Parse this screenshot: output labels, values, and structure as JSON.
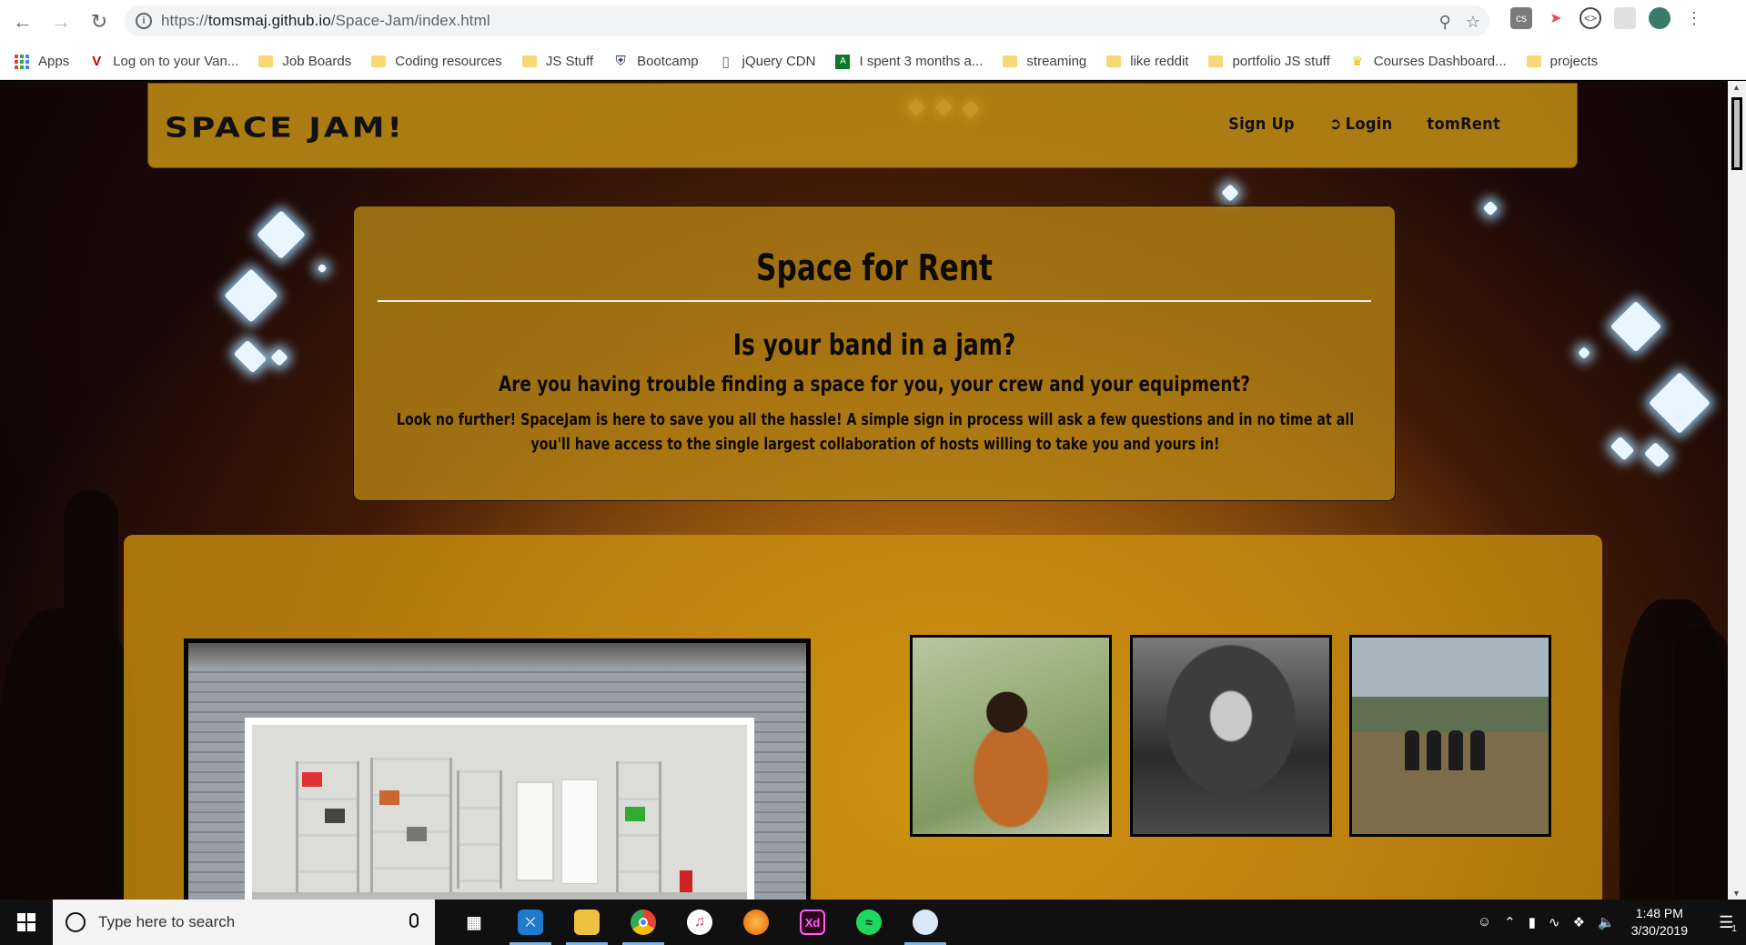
{
  "browser": {
    "url_scheme": "https://",
    "url_host": "tomsmaj.github.io",
    "url_path": "/Space-Jam/index.html",
    "bookmarks": [
      {
        "label": "Apps",
        "icon": "apps-grid-icon"
      },
      {
        "label": "Log on to your Van...",
        "icon": "vanguard-v-icon"
      },
      {
        "label": "Job Boards",
        "icon": "folder-icon"
      },
      {
        "label": "Coding resources",
        "icon": "folder-icon"
      },
      {
        "label": "JS Stuff",
        "icon": "folder-icon"
      },
      {
        "label": "Bootcamp",
        "icon": "shield-icon"
      },
      {
        "label": "jQuery CDN",
        "icon": "page-icon"
      },
      {
        "label": "I spent 3 months a...",
        "icon": "green-a-icon"
      },
      {
        "label": "streaming",
        "icon": "folder-icon"
      },
      {
        "label": "like reddit",
        "icon": "folder-icon"
      },
      {
        "label": "portfolio JS stuff",
        "icon": "folder-icon"
      },
      {
        "label": "Courses Dashboard...",
        "icon": "crown-icon"
      },
      {
        "label": "projects",
        "icon": "folder-icon"
      }
    ]
  },
  "site": {
    "brand": "SPACE JAM!",
    "nav": {
      "signup": "Sign Up",
      "login": "Login",
      "user": "tomRent"
    },
    "jumbo": {
      "title": "Space for Rent",
      "heading": "Is your band in a jam?",
      "subheading": "Are you having trouble finding a space for you, your crew and your equipment?",
      "body": "Look no further! SpaceJam is here to save you all the hassle! A simple sign in process will ask a few questions and in no time at all you'll have access to the single largest collaboration of hosts willing to take you and yours in!"
    }
  },
  "taskbar": {
    "search_placeholder": "Type here to search",
    "time": "1:48 PM",
    "date": "3/30/2019",
    "notification_count": "1",
    "apps": [
      "task-view",
      "vscode",
      "file-explorer",
      "chrome",
      "itunes",
      "firefox",
      "adobe-xd",
      "spotify",
      "paint"
    ]
  },
  "colors": {
    "panel_gold": "#be8c14",
    "text_dark": "#111111",
    "taskbar": "#101010"
  }
}
